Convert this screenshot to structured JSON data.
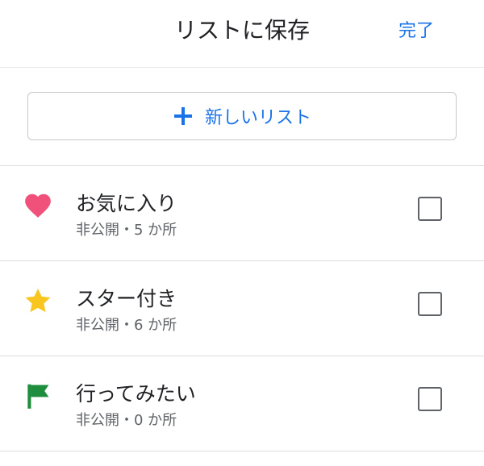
{
  "header": {
    "title": "リストに保存",
    "done_label": "完了"
  },
  "new_list": {
    "label": "新しいリスト",
    "icon": "plus-icon"
  },
  "lists": [
    {
      "name": "お気に入り",
      "meta": "非公開・5 か所",
      "icon": "heart-icon",
      "icon_color": "#f0517a",
      "checked": false
    },
    {
      "name": "スター付き",
      "meta": "非公開・6 か所",
      "icon": "star-icon",
      "icon_color": "#f8c61e",
      "checked": false
    },
    {
      "name": "行ってみたい",
      "meta": "非公開・0 か所",
      "icon": "flag-icon",
      "icon_color": "#1e8e3e",
      "checked": false
    }
  ],
  "colors": {
    "accent": "#1a73e8",
    "text_primary": "#202124",
    "text_secondary": "#5f6368",
    "divider": "#dadce0"
  }
}
